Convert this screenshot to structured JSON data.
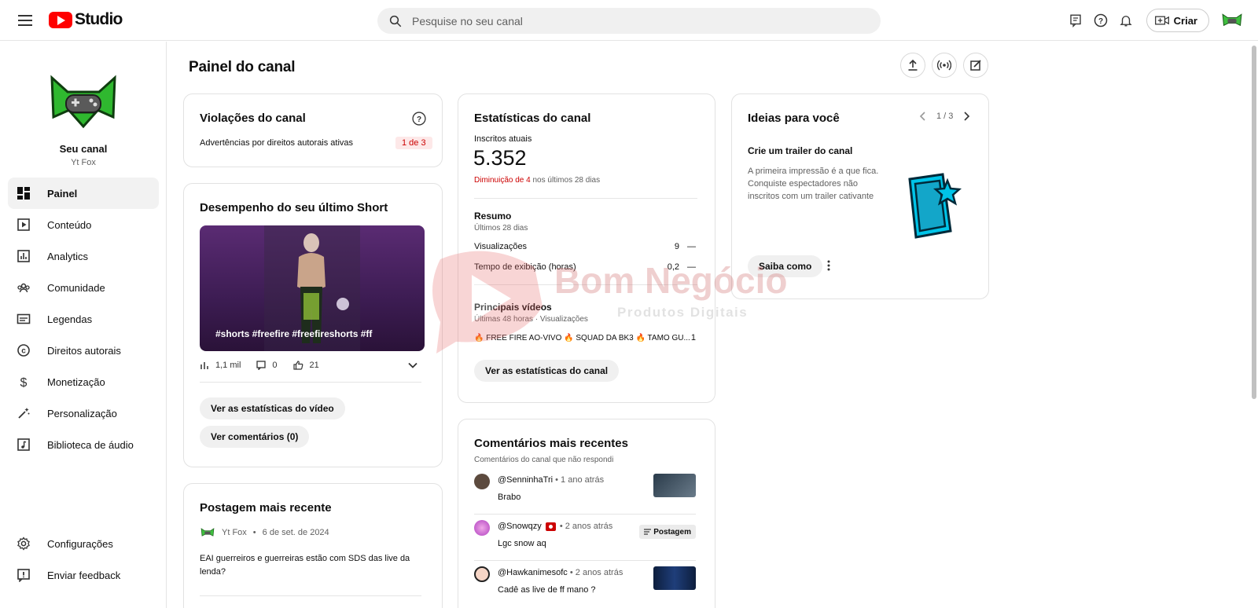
{
  "header": {
    "logo_text": "Studio",
    "search_placeholder": "Pesquise no seu canal",
    "create_label": "Criar"
  },
  "sidebar": {
    "channel_label": "Seu canal",
    "channel_handle": "Yt Fox",
    "items": [
      {
        "label": "Painel",
        "icon": "dashboard-icon",
        "active": true
      },
      {
        "label": "Conteúdo",
        "icon": "content-icon"
      },
      {
        "label": "Analytics",
        "icon": "analytics-icon"
      },
      {
        "label": "Comunidade",
        "icon": "community-icon"
      },
      {
        "label": "Legendas",
        "icon": "subtitles-icon"
      },
      {
        "label": "Direitos autorais",
        "icon": "copyright-icon"
      },
      {
        "label": "Monetização",
        "icon": "dollar-icon"
      },
      {
        "label": "Personalização",
        "icon": "magic-wand-icon"
      },
      {
        "label": "Biblioteca de áudio",
        "icon": "audio-library-icon"
      }
    ],
    "bottom_items": [
      {
        "label": "Configurações",
        "icon": "gear-icon"
      },
      {
        "label": "Enviar feedback",
        "icon": "feedback-icon"
      }
    ]
  },
  "main": {
    "title": "Painel do canal"
  },
  "violations": {
    "title": "Violações do canal",
    "text": "Advertências por direitos autorais ativas",
    "badge": "1 de 3"
  },
  "short": {
    "title": "Desempenho do seu último Short",
    "caption": "#shorts #freefire #freefireshorts #ff",
    "views": "1,1 mil",
    "comments": "0",
    "likes": "21",
    "btn_stats": "Ver as estatísticas do vídeo",
    "btn_comments": "Ver comentários (0)"
  },
  "post": {
    "title": "Postagem mais recente",
    "author": "Yt Fox",
    "date": "6 de set. de 2024",
    "text": "EAI guerreiros e guerreiras estão com SDS das live da lenda?"
  },
  "stats": {
    "title": "Estatísticas do canal",
    "subs_label": "Inscritos atuais",
    "subs_value": "5.352",
    "change_highlight": "Diminuição de 4",
    "change_rest": " nos últimos 28 dias",
    "summary_title": "Resumo",
    "summary_period": "Últimos 28 dias",
    "rows": [
      {
        "label": "Visualizações",
        "value": "9",
        "trend": "—"
      },
      {
        "label": "Tempo de exibição (horas)",
        "value": "0,2",
        "trend": "—"
      }
    ],
    "top_title": "Principais vídeos",
    "top_period": "Últimas 48 horas · Visualizações",
    "top_video": "🔥 FREE FIRE AO-VIVO 🔥 SQUAD DA BK3 🔥 TAMO GU...",
    "top_views": "1",
    "btn": "Ver as estatísticas do canal"
  },
  "comments": {
    "title": "Comentários mais recentes",
    "subtitle": "Comentários do canal que não respondi",
    "items": [
      {
        "user": "@SenninhaTri",
        "time": "• 1 ano atrás",
        "text": "Brabo"
      },
      {
        "user": "@Snowqzy",
        "time": "• 2 anos atrás",
        "text": "Lgc snow aq",
        "badge": "Postagem"
      },
      {
        "user": "@Hawkanimesofc",
        "time": "• 2 anos atrás",
        "text": "Cadê as live de ff mano ?"
      }
    ]
  },
  "ideas": {
    "title": "Ideias para você",
    "pager": "1 / 3",
    "idea_title": "Crie um trailer do canal",
    "idea_text": "A primeira impressão é a que fica. Conquiste espectadores não inscritos com um trailer cativante",
    "btn": "Saiba como"
  },
  "watermark": {
    "title": "Bom Negócio",
    "subtitle": "Produtos Digitais"
  }
}
